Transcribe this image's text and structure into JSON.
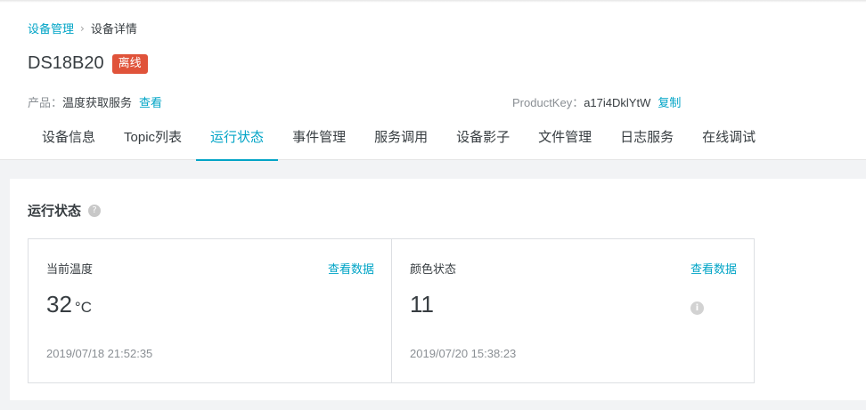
{
  "breadcrumb": {
    "parent": "设备管理",
    "separator": "›",
    "current": "设备详情"
  },
  "device": {
    "name": "DS18B20",
    "status": "离线"
  },
  "meta": {
    "product_label": "产品：",
    "product_value": "温度获取服务",
    "product_link": "查看",
    "key_label": "ProductKey：",
    "key_value": "a17i4DklYtW",
    "key_link": "复制"
  },
  "tabs": [
    {
      "label": "设备信息"
    },
    {
      "label": "Topic列表"
    },
    {
      "label": "运行状态"
    },
    {
      "label": "事件管理"
    },
    {
      "label": "服务调用"
    },
    {
      "label": "设备影子"
    },
    {
      "label": "文件管理"
    },
    {
      "label": "日志服务"
    },
    {
      "label": "在线调试"
    }
  ],
  "active_tab": 2,
  "section": {
    "title": "运行状态",
    "help_icon": "?"
  },
  "cards": [
    {
      "label": "当前温度",
      "link": "查看数据",
      "value": "32",
      "unit": "°C",
      "time": "2019/07/18 21:52:35"
    },
    {
      "label": "颜色状态",
      "link": "查看数据",
      "value": "11",
      "unit": "",
      "time": "2019/07/20 15:38:23",
      "info_icon": "i"
    }
  ],
  "colors": {
    "accent": "#00a4c6",
    "badge": "#e0533a"
  }
}
